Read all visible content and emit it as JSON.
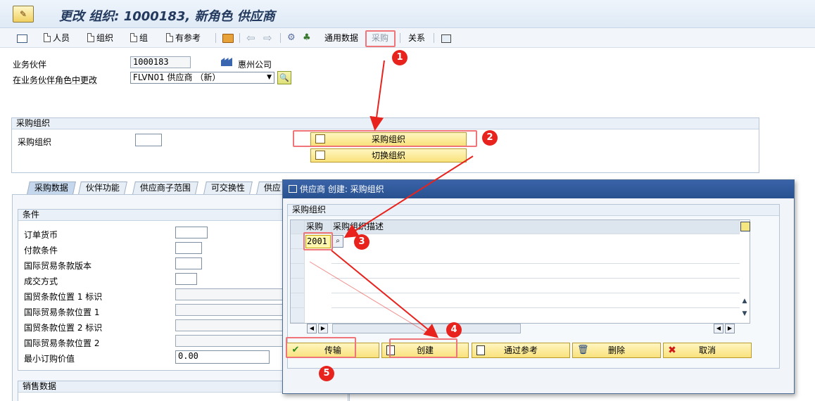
{
  "title_icon": "edit-document-icon",
  "page_title": "更改 组织: 1000183, 新角色 供应商",
  "toolbar": {
    "person": "人员",
    "org": "组织",
    "group": "组",
    "with_ref": "有参考",
    "general_data": "通用数据",
    "purchasing": "采购",
    "relations": "关系"
  },
  "header": {
    "bp_label": "业务伙伴",
    "bp_value": "1000183",
    "bp_name": "惠州公司",
    "role_label": "在业务伙伴角色中更改",
    "role_value": "FLVN01 供应商 （新）"
  },
  "purch_org_box": {
    "title": "采购组织",
    "field_label": "采购组织",
    "field_value": "",
    "btn_purch_org": "采购组织",
    "btn_switch_org": "切换组织"
  },
  "tabs": [
    "采购数据",
    "伙伴功能",
    "供应商子范围",
    "可交换性",
    "供应"
  ],
  "conditions": {
    "title": "条件",
    "rows": [
      {
        "label": "订单货币",
        "value": ""
      },
      {
        "label": "付款条件",
        "value": ""
      },
      {
        "label": "国际贸易条款版本",
        "value": ""
      },
      {
        "label": "成交方式",
        "value": ""
      },
      {
        "label": "国贸条款位置 1 标识",
        "value": ""
      },
      {
        "label": "国际贸易条款位置 1",
        "value": ""
      },
      {
        "label": "国贸条款位置 2 标识",
        "value": ""
      },
      {
        "label": "国际贸易条款位置 2",
        "value": ""
      },
      {
        "label": "最小订购价值",
        "value": "0.00"
      }
    ],
    "sales_title": "销售数据"
  },
  "dialog": {
    "title": "供应商 创建: 采购组织",
    "group_title": "采购组织",
    "col_purch": "采购",
    "col_desc": "采购组织描述",
    "row1_value": "2001",
    "buttons": {
      "transfer": "传输",
      "create": "创建",
      "by_ref": "通过参考",
      "delete": "删除",
      "cancel": "取消"
    }
  },
  "badges": [
    "1",
    "2",
    "3",
    "4",
    "5"
  ],
  "colors": {
    "annotation_red": "#e8231d",
    "highlight_box": "#f0757a",
    "title_blue": "#233a5e"
  }
}
